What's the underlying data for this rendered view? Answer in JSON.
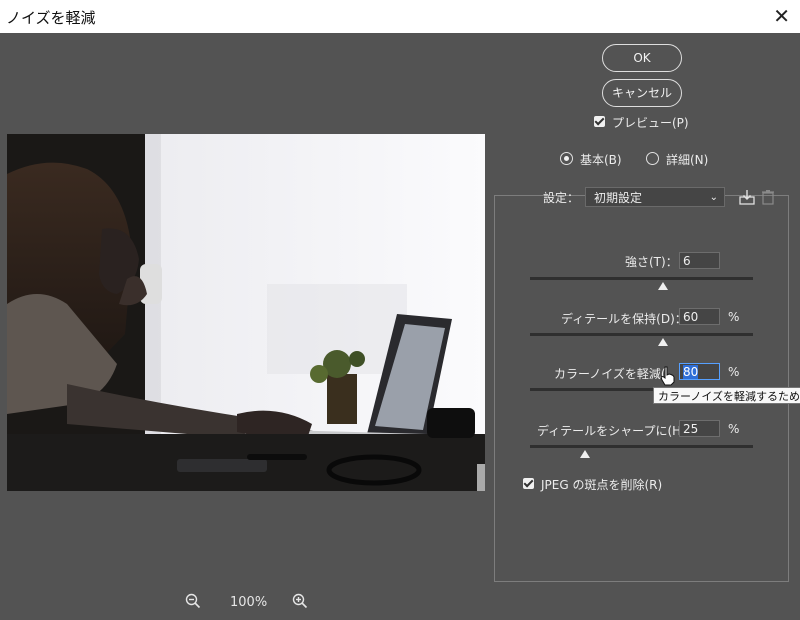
{
  "window": {
    "title": "ノイズを軽減",
    "close_glyph": "✕"
  },
  "buttons": {
    "ok": "OK",
    "cancel": "キャンセル"
  },
  "preview_toggle": {
    "label": "プレビュー(P)",
    "checked": true
  },
  "mode": {
    "basic": "基本(B)",
    "advanced": "詳細(N)",
    "selected": "basic"
  },
  "settings": {
    "label": "設定：",
    "value": "初期設定"
  },
  "sliders": [
    {
      "label": "強さ(T)：",
      "value": "6",
      "unit": ""
    },
    {
      "label": "ディテールを保持(D)：",
      "value": "60",
      "unit": "%"
    },
    {
      "label": "カラーノイズを軽減(",
      "value": "80",
      "unit": "%"
    },
    {
      "label": "ディテールをシャープに(H)：",
      "value": "25",
      "unit": "%"
    }
  ],
  "tooltip": "カラーノイズを軽減するための強",
  "jpeg_option": {
    "label": "JPEG の斑点を削除(R)",
    "checked": true
  },
  "zoom": {
    "level": "100%"
  },
  "icons": {
    "zoom_out": "zoom-out-icon",
    "zoom_in": "zoom-in-icon",
    "save_preset": "save-preset-icon",
    "delete_preset": "trash-icon",
    "pointer": "hand-cursor-icon"
  },
  "colors": {
    "background": "#535353",
    "panel_border": "#7d7d7d",
    "accent": "#2f6fd8"
  }
}
